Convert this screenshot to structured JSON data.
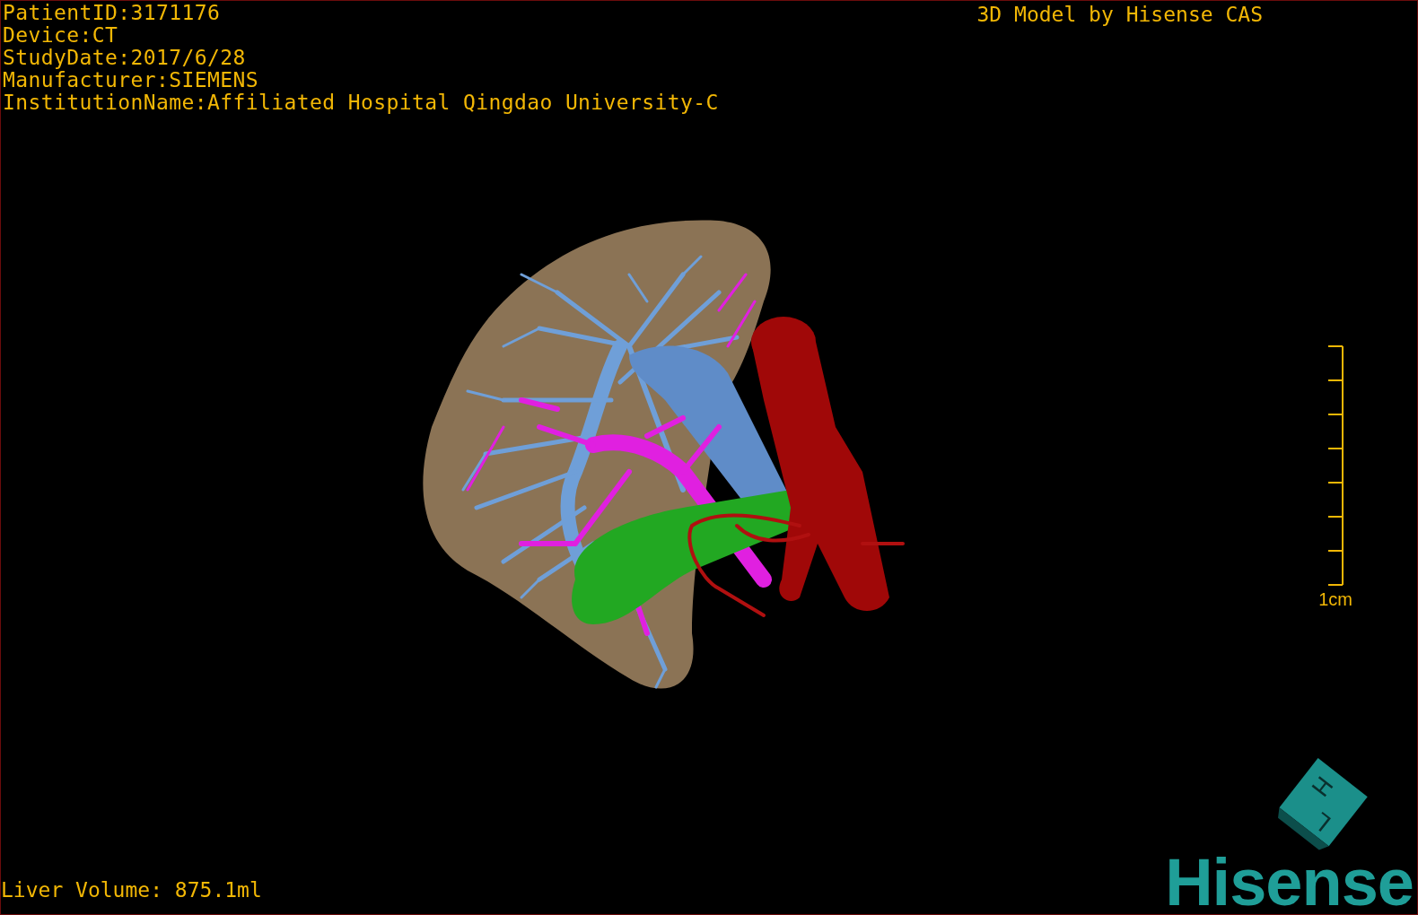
{
  "info_lines": [
    "PatientID:3171176",
    "Device:CT",
    "StudyDate:2017/6/28",
    "Manufacturer:SIEMENS",
    "InstitutionName:Affiliated Hospital Qingdao University-C"
  ],
  "title": "3D Model by Hisense CAS",
  "scale_bar": {
    "label": "1cm"
  },
  "orientation_cube": {
    "faces": [
      "H",
      "L"
    ]
  },
  "logo": "Hisense",
  "liver_volume": "Liver Volume: 875.1ml"
}
